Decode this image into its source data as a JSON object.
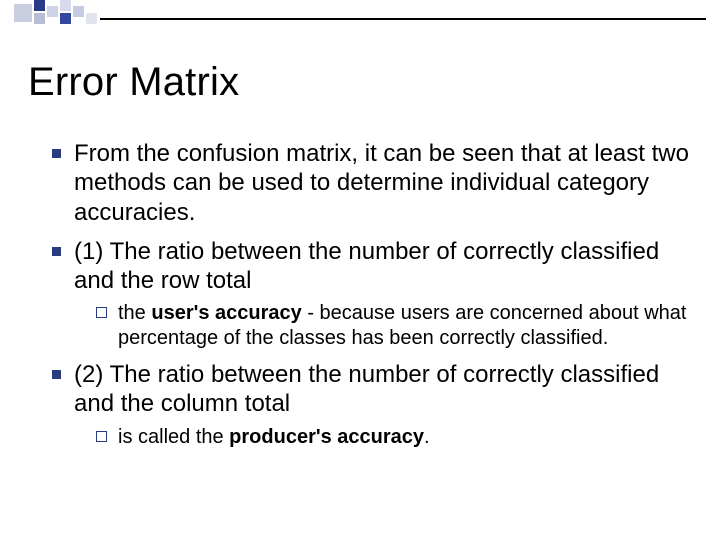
{
  "title": "Error Matrix",
  "bullets": {
    "b1": "From the confusion matrix, it can be seen that at least two methods can be used to determine individual category accuracies.",
    "b2": "(1) The ratio between the number of correctly classified and the row total",
    "b2sub_prefix": "the ",
    "b2sub_bold": "user's accuracy",
    "b2sub_rest": " - because users are concerned about what percentage of the classes has been correctly classified.",
    "b3": "(2) The ratio between the number of correctly classified and the column total",
    "b3sub_prefix": "is called the ",
    "b3sub_bold": "producer's accuracy",
    "b3sub_rest": "."
  }
}
